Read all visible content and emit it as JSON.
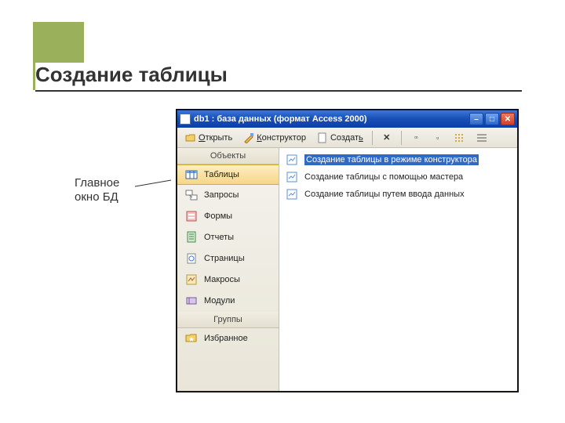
{
  "slide": {
    "title": "Создание таблицы",
    "annotation_line1": "Главное",
    "annotation_line2": "окно БД"
  },
  "window": {
    "title": "db1 : база данных (формат Access 2000)"
  },
  "toolbar": {
    "open": "Открыть",
    "design": "Конструктор",
    "create": "Создать"
  },
  "sidebar": {
    "header_objects": "Объекты",
    "header_groups": "Группы",
    "items": [
      {
        "label": "Таблицы"
      },
      {
        "label": "Запросы"
      },
      {
        "label": "Формы"
      },
      {
        "label": "Отчеты"
      },
      {
        "label": "Страницы"
      },
      {
        "label": "Макросы"
      },
      {
        "label": "Модули"
      }
    ],
    "favorites": "Избранное"
  },
  "content": {
    "items": [
      {
        "label": "Создание таблицы в режиме конструктора"
      },
      {
        "label": "Создание таблицы с помощью мастера"
      },
      {
        "label": "Создание таблицы путем ввода данных"
      }
    ]
  }
}
